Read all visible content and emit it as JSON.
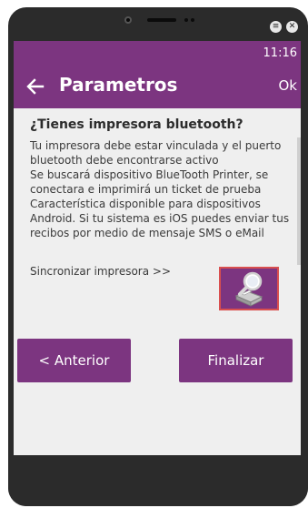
{
  "device": {
    "menu_icon": "menu-icon",
    "close_icon": "close-icon",
    "menu_glyph": "≡",
    "close_glyph": "✕"
  },
  "status_bar": {
    "time": "11:16"
  },
  "app_bar": {
    "title": "Parametros",
    "ok_label": "Ok",
    "back_icon": "arrow-left-icon"
  },
  "content": {
    "heading": "¿Tienes impresora bluetooth?",
    "lines": [
      "Tu impresora debe estar vinculada y el puerto",
      "bluetooth debe encontrarse activo",
      "Se buscará dispositivo BlueTooth Printer, se",
      "conectara e imprimirá un ticket de prueba",
      "Característica disponible para dispositivos",
      "Android. Si tu sistema es iOS puedes enviar tus",
      "recibos por medio de mensaje SMS o eMail"
    ],
    "sync_label": "Sincronizar impresora >>",
    "sync_icon": "printer-search-icon"
  },
  "buttons": {
    "prev_label": "< Anterior",
    "finish_label": "Finalizar"
  },
  "colors": {
    "primary": "#7c3580",
    "sync_border": "#d94f4f",
    "background": "#efefef"
  }
}
